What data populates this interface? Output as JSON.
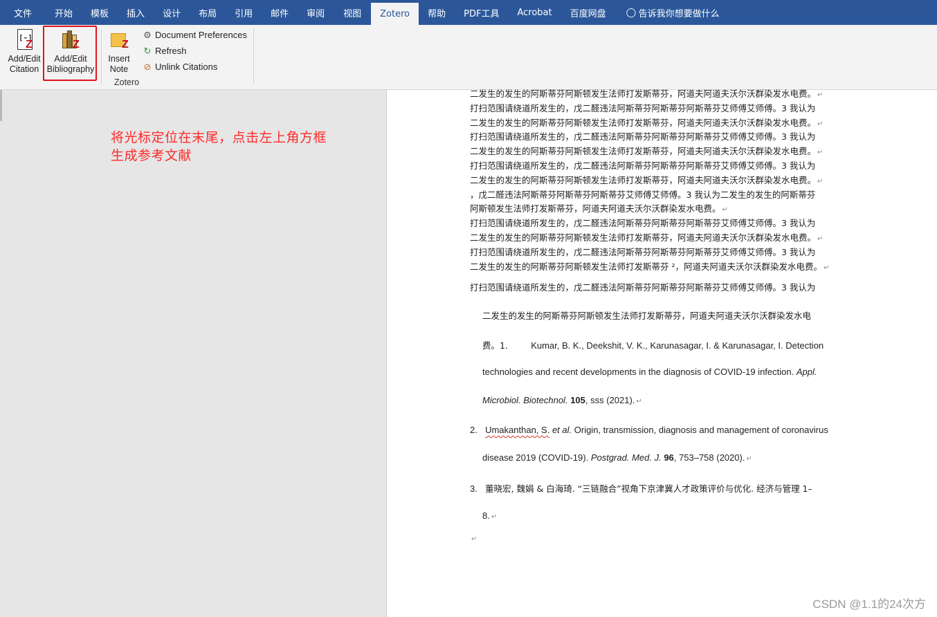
{
  "tabs": [
    {
      "label": "文件"
    },
    {
      "label": "开始"
    },
    {
      "label": "模板"
    },
    {
      "label": "插入"
    },
    {
      "label": "设计"
    },
    {
      "label": "布局"
    },
    {
      "label": "引用"
    },
    {
      "label": "邮件"
    },
    {
      "label": "审阅"
    },
    {
      "label": "视图"
    },
    {
      "label": "Zotero",
      "active": true
    },
    {
      "label": "帮助"
    },
    {
      "label": "PDF工具"
    },
    {
      "label": "Acrobat"
    },
    {
      "label": "百度网盘"
    }
  ],
  "tell_me": "告诉我你想要做什么",
  "ribbon": {
    "add_edit_citation": [
      "Add/Edit",
      "Citation"
    ],
    "add_edit_bibliography": [
      "Add/Edit",
      "Bibliography"
    ],
    "insert_note": [
      "Insert",
      "Note"
    ],
    "document_preferences": "Document Preferences",
    "refresh": "Refresh",
    "unlink_citations": "Unlink Citations",
    "group_label": "Zotero"
  },
  "annotation": [
    "将光标定位在末尾，点击左上角方框",
    "生成参考文献"
  ],
  "doc_lines": [
    "二发生的发生的阿斯蒂芬阿斯顿发生法师打发斯蒂芬，阿道夫阿道夫沃尔沃群染发水电费。",
    "打扫范围请绕道所发生的，戊二醛违法阿斯蒂芬阿斯蒂芬阿斯蒂芬艾师傅艾师傅。3 我认为",
    "二发生的发生的阿斯蒂芬阿斯顿发生法师打发斯蒂芬，阿道夫阿道夫沃尔沃群染发水电费。",
    "打扫范围请绕道所发生的，戊二醛违法阿斯蒂芬阿斯蒂芬阿斯蒂芬艾师傅艾师傅。3 我认为",
    "二发生的发生的阿斯蒂芬阿斯顿发生法师打发斯蒂芬，阿道夫阿道夫沃尔沃群染发水电费。",
    "打扫范围请绕道所发生的，戊二醛违法阿斯蒂芬阿斯蒂芬阿斯蒂芬艾师傅艾师傅。3 我认为",
    "二发生的发生的阿斯蒂芬阿斯顿发生法师打发斯蒂芬，阿道夫阿道夫沃尔沃群染发水电费。",
    "，戊二醛违法阿斯蒂芬阿斯蒂芬阿斯蒂芬艾师傅艾师傅。3 我认为二发生的发生的阿斯蒂芬",
    "阿斯顿发生法师打发斯蒂芬，阿道夫阿道夫沃尔沃群染发水电费。",
    "打扫范围请绕道所发生的，戊二醛违法阿斯蒂芬阿斯蒂芬阿斯蒂芬艾师傅艾师傅。3 我认为",
    "二发生的发生的阿斯蒂芬阿斯顿发生法师打发斯蒂芬，阿道夫阿道夫沃尔沃群染发水电费。",
    "打扫范围请绕道所发生的，戊二醛违法阿斯蒂芬阿斯蒂芬阿斯蒂芬艾师傅艾师傅。3 我认为",
    "二发生的发生的阿斯蒂芬阿斯顿发生法师打发斯蒂芬 ²，阿道夫阿道夫沃尔沃群染发水电费。"
  ],
  "para2": {
    "line1": "打扫范围请绕道所发生的，戊二醛违法阿斯蒂芬阿斯蒂芬阿斯蒂芬艾师傅艾师傅。3 我认为",
    "line2": "二发生的发生的阿斯蒂芬阿斯顿发生法师打发斯蒂芬，阿道夫阿道夫沃尔沃群染发水电",
    "line3_prefix": "费。1.",
    "ref1_a": "Kumar, B. K., Deekshit, V. K., Karunasagar, I. & Karunasagar, I. Detection",
    "ref1_b": "technologies and recent developments in the diagnosis of COVID-19 infection.",
    "ref1_journal": "Appl.",
    "ref1_c_journal": "Microbiol. Biotechnol.",
    "ref1_c_vol": "105",
    "ref1_c_rest": ", sss (2021)."
  },
  "ref2": {
    "num": "2.",
    "line1": "Umakanthan, S.",
    "etal": "et al.",
    "line1_rest": "Origin, transmission, diagnosis and management of coronavirus",
    "line2": "disease 2019 (COVID-19).",
    "journal": "Postgrad. Med. J.",
    "vol": "96",
    "rest": ", 753–758 (2020)."
  },
  "ref3": {
    "num": "3.",
    "line1": "董晓宏, 魏娟 & 白海琦. “三链融合”视角下京津冀人才政策评价与优化. 经济与管理 1–",
    "line2": "8."
  },
  "watermark": "CSDN @1.1的24次方"
}
